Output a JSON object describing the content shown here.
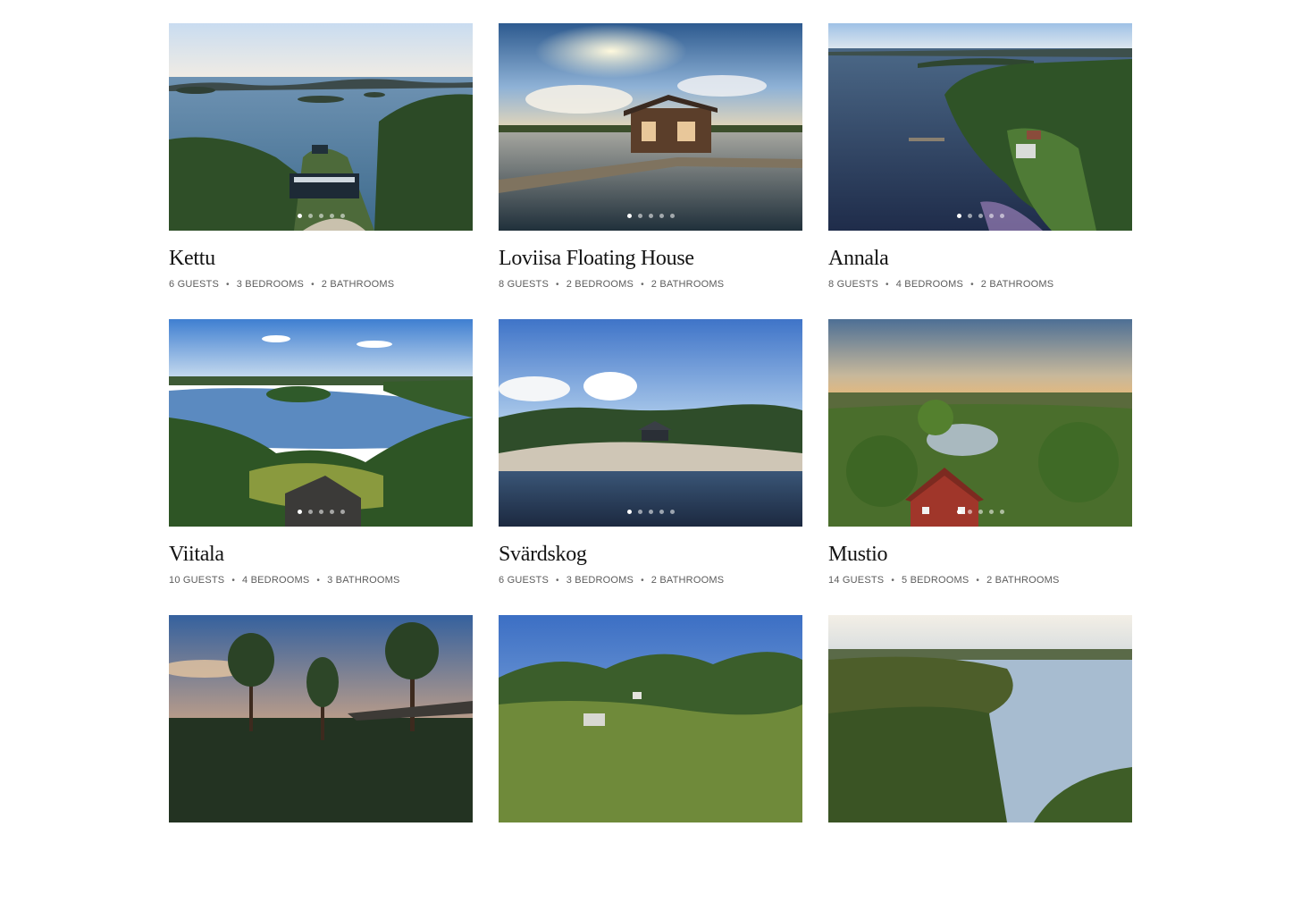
{
  "listings": [
    {
      "name": "Kettu",
      "guests": "6 GUESTS",
      "bedrooms": "3 BEDROOMS",
      "bathrooms": "2 BATHROOMS",
      "dots": 5,
      "active_dot": 1,
      "scene": "archipelago"
    },
    {
      "name": "Loviisa Floating House",
      "guests": "8 GUESTS",
      "bedrooms": "2 BEDROOMS",
      "bathrooms": "2 BATHROOMS",
      "dots": 5,
      "active_dot": 1,
      "scene": "floating"
    },
    {
      "name": "Annala",
      "guests": "8 GUESTS",
      "bedrooms": "4 BEDROOMS",
      "bathrooms": "2 BATHROOMS",
      "dots": 5,
      "active_dot": 1,
      "scene": "lakeshore"
    },
    {
      "name": "Viitala",
      "guests": "10 GUESTS",
      "bedrooms": "4 BEDROOMS",
      "bathrooms": "3 BATHROOMS",
      "dots": 5,
      "active_dot": 1,
      "scene": "forestlake"
    },
    {
      "name": "Svärdskog",
      "guests": "6 GUESTS",
      "bedrooms": "3 BEDROOMS",
      "bathrooms": "2 BATHROOMS",
      "dots": 5,
      "active_dot": 1,
      "scene": "rockyshore"
    },
    {
      "name": "Mustio",
      "guests": "14 GUESTS",
      "bedrooms": "5 BEDROOMS",
      "bathrooms": "2 BATHROOMS",
      "dots": 5,
      "active_dot": 1,
      "scene": "redhouse"
    },
    {
      "name": "",
      "guests": "",
      "bedrooms": "",
      "bathrooms": "",
      "dots": 0,
      "active_dot": 0,
      "scene": "sunsetpines"
    },
    {
      "name": "",
      "guests": "",
      "bedrooms": "",
      "bathrooms": "",
      "dots": 0,
      "active_dot": 0,
      "scene": "hillforest"
    },
    {
      "name": "",
      "guests": "",
      "bedrooms": "",
      "bathrooms": "",
      "dots": 0,
      "active_dot": 0,
      "scene": "hazylake"
    }
  ],
  "separator": "•",
  "colors": {
    "title": "#141414",
    "meta": "#5c5c5c",
    "background": "#ffffff"
  }
}
